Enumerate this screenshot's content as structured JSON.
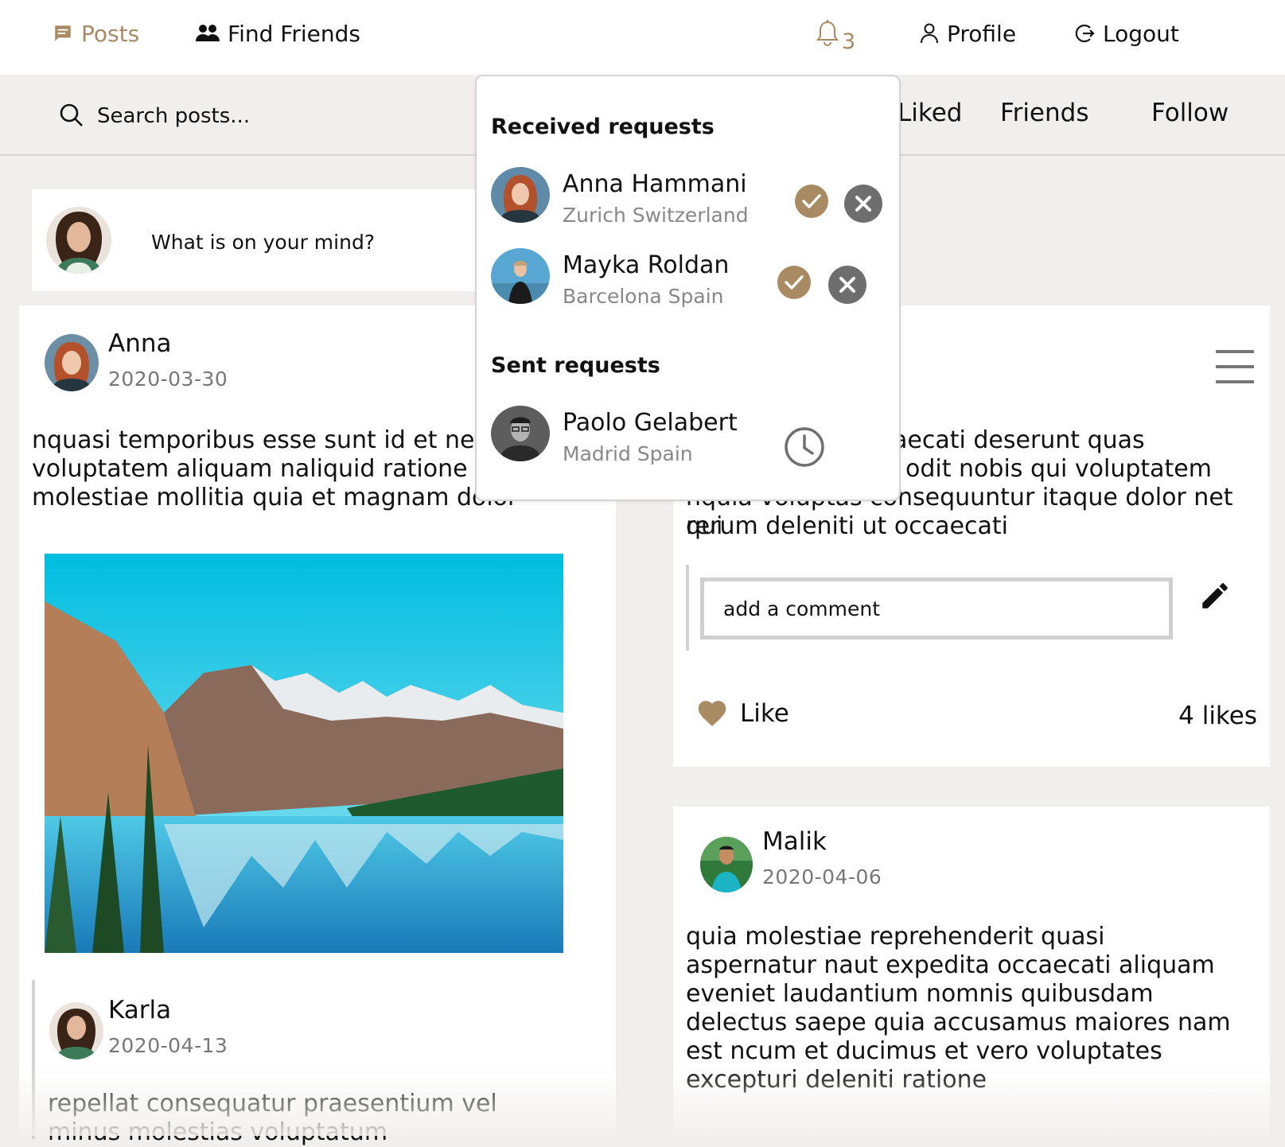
{
  "nav": {
    "posts": "Posts",
    "find_friends": "Find Friends",
    "notifications_count": "3",
    "profile": "Profile",
    "logout": "Logout"
  },
  "search": {
    "placeholder": "Search posts..."
  },
  "tabs": {
    "liked": "Liked",
    "friends": "Friends",
    "follow": "Follow"
  },
  "composer": {
    "prompt": "What is on your mind?"
  },
  "posts": [
    {
      "author": "Anna",
      "date": "2020-03-30",
      "text": "nquasi temporibus esse sunt id et neos voluptatem aliquam naliquid ratione co molestiae mollitia quia et magnam dolor",
      "comment": {
        "author": "Karla",
        "date": "2020-04-13",
        "text": "repellat consequatur praesentium vel minus molestias voluptatum"
      }
    },
    {
      "text_lines": [
        "aecati deserunt quas",
        "odit nobis qui voluptatem",
        "nquia voluptas consequuntur itaque dolor net qui",
        "rerum deleniti ut occaecati"
      ],
      "comment_placeholder": "add a comment",
      "like_label": "Like",
      "likes": "4 likes"
    },
    {
      "author": "Malik",
      "date": "2020-04-06",
      "text": "quia molestiae reprehenderit quasi aspernatur naut expedita occaecati aliquam eveniet laudantium nomnis quibusdam delectus saepe quia accusamus maiores nam est ncum et ducimus et vero voluptates excepturi deleniti ratione"
    }
  ],
  "friend_requests": {
    "received_heading": "Received requests",
    "received": [
      {
        "name": "Anna Hammani",
        "location": "Zurich Switzerland"
      },
      {
        "name": "Mayka Roldan",
        "location": "Barcelona Spain"
      }
    ],
    "sent_heading": "Sent requests",
    "sent": [
      {
        "name": "Paolo Gelabert",
        "location": "Madrid Spain"
      }
    ]
  },
  "colors": {
    "accent": "#a88b63",
    "background": "#f1efee",
    "decline": "#6e6e6e"
  }
}
